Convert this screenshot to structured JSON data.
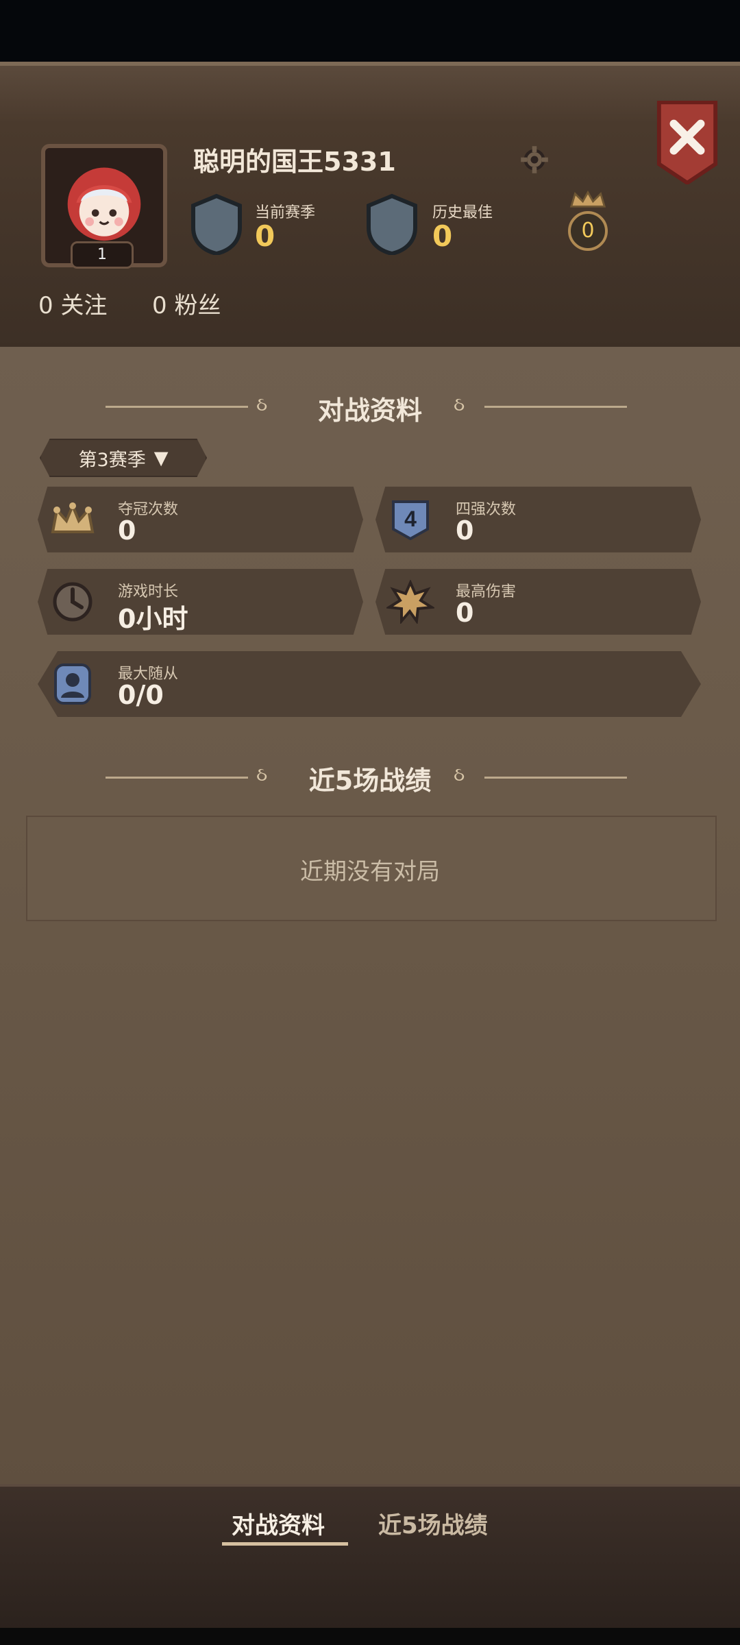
{
  "profile": {
    "username": "聪明的国王5331",
    "level": "1",
    "current_season_label": "当前赛季",
    "current_season_value": "0",
    "history_best_label": "历史最佳",
    "history_best_value": "0",
    "coins": "0",
    "follow": "0 关注",
    "fans": "0 粉丝"
  },
  "sections": {
    "battle_info_title": "对战资料",
    "recent_title": "近5场战绩",
    "season_select": "第3赛季",
    "recent_empty": "近期没有对局"
  },
  "stats": [
    {
      "label": "夺冠次数",
      "value": "0",
      "icon": "crown-icon"
    },
    {
      "label": "四强次数",
      "value": "0",
      "icon": "four-icon"
    },
    {
      "label": "游戏时长",
      "value": "0小时",
      "icon": "clock-icon"
    },
    {
      "label": "最高伤害",
      "value": "0",
      "icon": "damage-icon"
    },
    {
      "label": "最大随从",
      "value": "0/0",
      "icon": "minion-icon"
    }
  ],
  "tabs": [
    {
      "label": "对战资料",
      "active": true
    },
    {
      "label": "近5场战绩",
      "active": false
    }
  ]
}
